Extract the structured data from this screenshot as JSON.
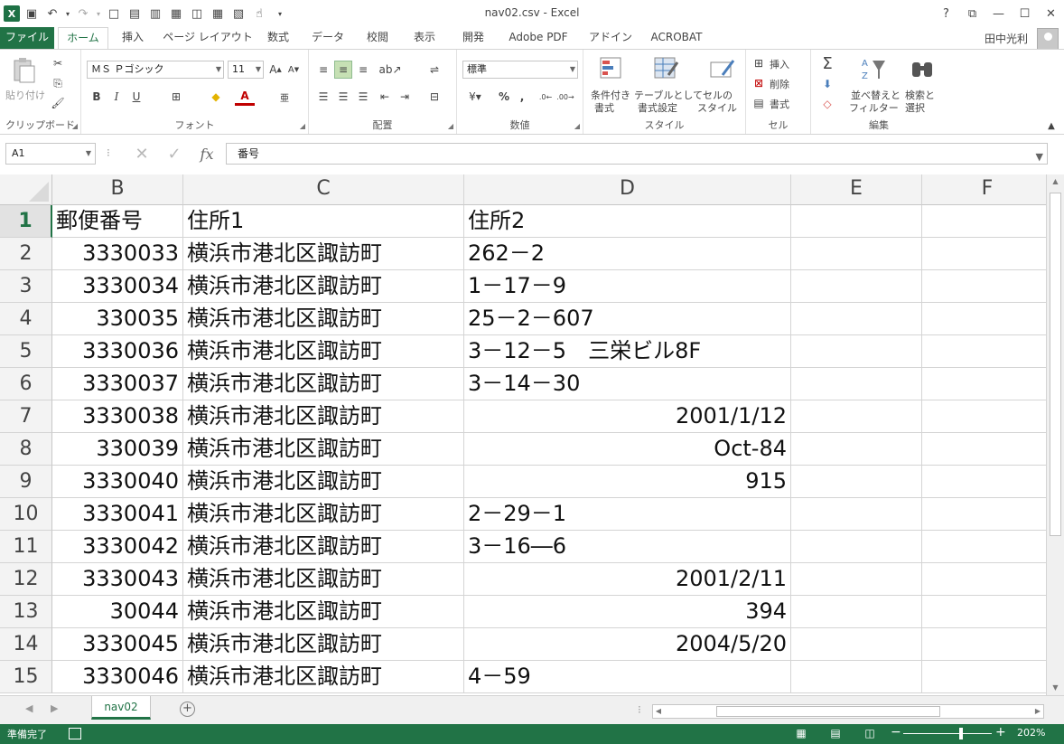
{
  "window": {
    "title": "nav02.csv - Excel"
  },
  "user": {
    "name": "田中光利"
  },
  "tabs": [
    {
      "label": "ファイル"
    },
    {
      "label": "ホーム"
    },
    {
      "label": "挿入"
    },
    {
      "label": "ページ レイアウト"
    },
    {
      "label": "数式"
    },
    {
      "label": "データ"
    },
    {
      "label": "校閲"
    },
    {
      "label": "表示"
    },
    {
      "label": "開発"
    },
    {
      "label": "Adobe PDF"
    },
    {
      "label": "アドイン"
    },
    {
      "label": "ACROBAT"
    }
  ],
  "ribbon": {
    "groups": {
      "clipboard": "クリップボード",
      "font": "フォント",
      "alignment": "配置",
      "number": "数値",
      "styles": "スタイル",
      "cells": "セル",
      "editing": "編集"
    },
    "paste_label": "貼り付け",
    "font_name": "ＭＳ Ｐゴシック",
    "font_size": "11",
    "number_format": "標準",
    "conditional_format": [
      "条件付き",
      "書式"
    ],
    "format_as_table": [
      "テーブルとして",
      "書式設定"
    ],
    "cell_styles": [
      "セルの",
      "スタイル"
    ],
    "insert": "挿入",
    "delete": "削除",
    "format": "書式",
    "sort_filter": [
      "並べ替えと",
      "フィルター"
    ],
    "find_select": [
      "検索と",
      "選択"
    ]
  },
  "formula_bar": {
    "name_box": "A1",
    "content": "番号"
  },
  "columns": [
    "B",
    "C",
    "D",
    "E",
    "F"
  ],
  "rows": [
    {
      "num": "1",
      "B": "郵便番号",
      "C": "住所1",
      "D": "住所2"
    },
    {
      "num": "2",
      "B": "3330033",
      "C": "横浜市港北区諏訪町",
      "D": "262－2"
    },
    {
      "num": "3",
      "B": "3330034",
      "C": "横浜市港北区諏訪町",
      "D": "1－17－9"
    },
    {
      "num": "4",
      "B": "330035",
      "C": "横浜市港北区諏訪町",
      "D": "25－2－607"
    },
    {
      "num": "5",
      "B": "3330036",
      "C": "横浜市港北区諏訪町",
      "D": "3－12－5　三栄ビル8F"
    },
    {
      "num": "6",
      "B": "3330037",
      "C": "横浜市港北区諏訪町",
      "D": "3－14－30"
    },
    {
      "num": "7",
      "B": "3330038",
      "C": "横浜市港北区諏訪町",
      "D": "2001/1/12"
    },
    {
      "num": "8",
      "B": "330039",
      "C": "横浜市港北区諏訪町",
      "D": "Oct-84"
    },
    {
      "num": "9",
      "B": "3330040",
      "C": "横浜市港北区諏訪町",
      "D": "915"
    },
    {
      "num": "10",
      "B": "3330041",
      "C": "横浜市港北区諏訪町",
      "D": "2－29－1"
    },
    {
      "num": "11",
      "B": "3330042",
      "C": "横浜市港北区諏訪町",
      "D": "3－16―6"
    },
    {
      "num": "12",
      "B": "3330043",
      "C": "横浜市港北区諏訪町",
      "D": "2001/2/11"
    },
    {
      "num": "13",
      "B": "30044",
      "C": "横浜市港北区諏訪町",
      "D": "394"
    },
    {
      "num": "14",
      "B": "3330045",
      "C": "横浜市港北区諏訪町",
      "D": "2004/5/20"
    },
    {
      "num": "15",
      "B": "3330046",
      "C": "横浜市港北区諏訪町",
      "D": "4－59"
    }
  ],
  "right_aligned_d": [
    "2001/1/12",
    "Oct-84",
    "915",
    "2001/2/11",
    "394",
    "2004/5/20"
  ],
  "sheet": {
    "tab": "nav02"
  },
  "status": {
    "ready": "準備完了",
    "zoom": "202%"
  },
  "colors": {
    "accent": "#217346"
  }
}
